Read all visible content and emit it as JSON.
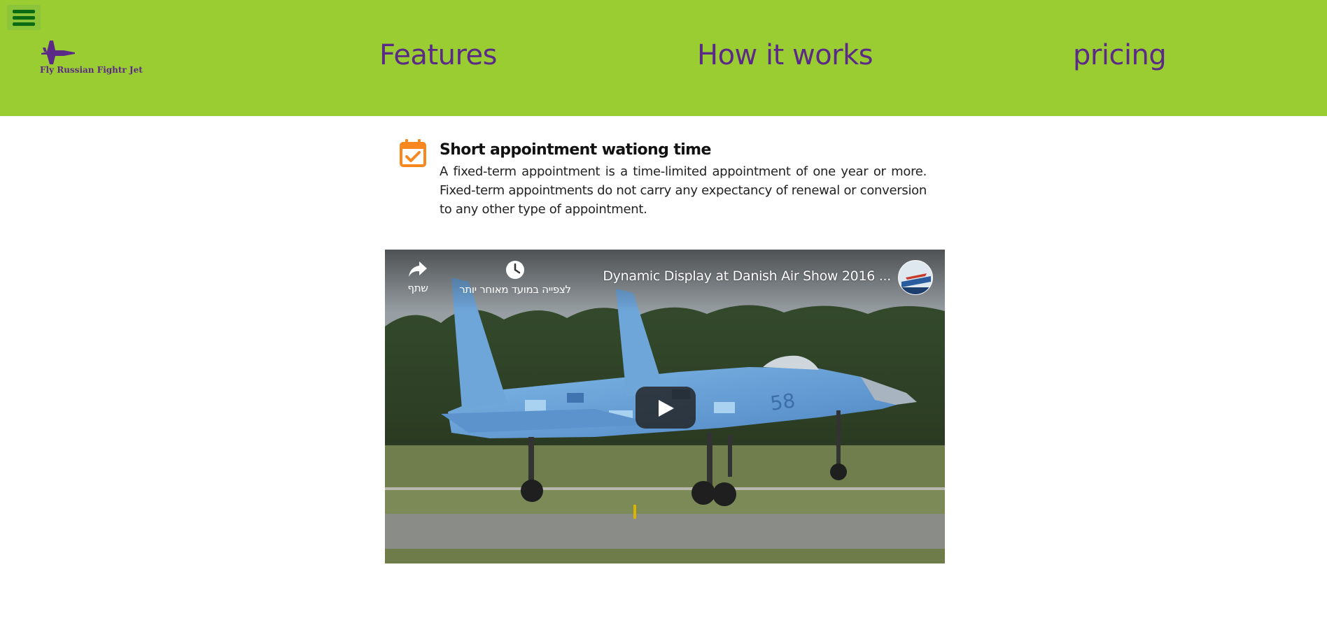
{
  "header": {
    "menu_icon": "hamburger-icon",
    "brand": {
      "icon": "fighter-jet-icon",
      "name": "Fly Russian Fightr Jet"
    },
    "nav": [
      {
        "label": "Features"
      },
      {
        "label": "How it works"
      },
      {
        "label": "pricing"
      }
    ],
    "colors": {
      "background": "#9acd32",
      "link": "#5b2a86",
      "menu": "#0b6b12"
    }
  },
  "feature": {
    "icon": "calendar-check-icon",
    "icon_color": "#f7871e",
    "title": "Short appointment wationg time",
    "text": "A fixed-term appointment is a time-limited appointment of one year or more. Fixed-term appointments do not carry any expectancy of renewal or conversion to any other type of appointment."
  },
  "video": {
    "title": "Dynamic Display at Danish Air Show 2016 ...",
    "share_label": "שתף",
    "watch_later_label": "לצפייה במועד מאוחר יותר",
    "icons": [
      "share-icon",
      "clock-icon",
      "play-icon",
      "channel-avatar"
    ]
  }
}
